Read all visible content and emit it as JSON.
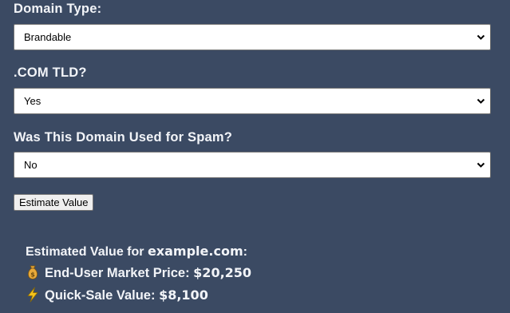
{
  "form": {
    "domain_type": {
      "label": "Domain Type:",
      "value": "Brandable"
    },
    "com_tld": {
      "label": ".COM TLD?",
      "value": "Yes"
    },
    "spam": {
      "label": "Was This Domain Used for Spam?",
      "value": "No"
    },
    "submit_label": "Estimate Value"
  },
  "result": {
    "title_prefix": "Estimated Value for",
    "domain": "example.com",
    "title_suffix": ":",
    "end_user": {
      "icon": "money-bag-icon",
      "label": "End-User Market Price:",
      "amount": "$20,250"
    },
    "quick_sale": {
      "icon": "lightning-icon",
      "label": "Quick-Sale Value:",
      "amount": "$8,100"
    }
  },
  "colors": {
    "background": "#3b4a63",
    "text": "#f2f4f8",
    "money_bag": "#e8a93a",
    "lightning": "#f4c21b"
  }
}
